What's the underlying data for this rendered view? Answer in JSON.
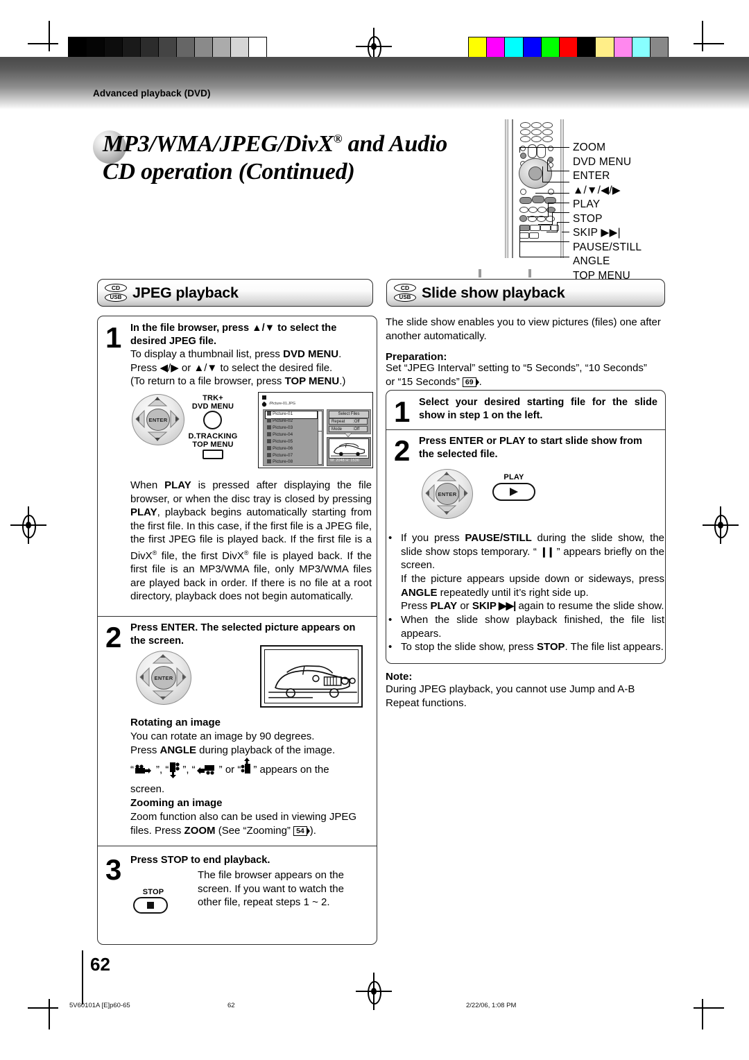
{
  "page": {
    "breadcrumb": "Advanced playback (DVD)",
    "title_line1": "MP3/WMA/JPEG/DivX",
    "title_reg": "®",
    "title_line1_tail": " and Audio",
    "title_line2": "CD operation (Continued)",
    "page_number": "62"
  },
  "remote": {
    "labels": [
      "ZOOM",
      "DVD MENU",
      "ENTER",
      "▲/▼/◀/▶",
      "PLAY",
      "STOP",
      "SKIP ▶▶|",
      "PAUSE/STILL",
      "ANGLE",
      "TOP MENU"
    ]
  },
  "left": {
    "heading": {
      "badge_cd": "CD",
      "badge_usb": "USB",
      "title": "JPEG playback"
    },
    "step1": {
      "num": "1",
      "title": "In the file browser, press ▲/▼ to select the desired JPEG file.",
      "body_line1_a": "To display a thumbnail list, press ",
      "body_line1_b": "DVD MENU",
      "body_line1_c": ".",
      "body_line2": "Press ◀/▶ or ▲/▼ to select the desired file.",
      "body_line3_a": "(To return to a file browser, press ",
      "body_line3_b": "TOP MENU",
      "body_line3_c": ".)"
    },
    "dpad1": {
      "center": "ENTER"
    },
    "dvdmenu_button": {
      "cap_line1": "TRK+",
      "cap_line2": "DVD MENU"
    },
    "topmenu_button": {
      "cap_line1": "D.TRACKING",
      "cap_line2": "TOP MENU"
    },
    "osd": {
      "path": "/Picture-01.JPG",
      "files": [
        "Picture-01",
        "Picture-02",
        "Picture-03",
        "Picture-04",
        "Picture-05",
        "Picture-06",
        "Picture-07",
        "Picture-08"
      ],
      "buttons": [
        "Select Files"
      ],
      "settings": [
        {
          "label": "Repeat",
          "value": ":Off"
        },
        {
          "label": "Mode",
          "value": ":Off"
        }
      ],
      "dimensions": "W: 2048  H: 1536"
    },
    "paragraph": {
      "p1_1": "When ",
      "p1_b1": "PLAY",
      "p1_2": " is pressed after displaying the file browser, or when the disc tray is closed by pressing ",
      "p1_b2": "PLAY",
      "p1_3": ", playback begins automatically starting from the first file. In this case, if the first file is a JPEG file, the first JPEG file is played back. If the first file is a DivX",
      "p1_r1": "®",
      "p1_4": " file, the first DivX",
      "p1_r2": "®",
      "p1_5": " file is played back. If the first file is an MP3/WMA file, only MP3/WMA files are played back in order. If there is no file at a root directory, playback does not begin automatically."
    },
    "step2": {
      "num": "2",
      "title": "Press ENTER. The selected picture appears on the screen."
    },
    "rotating": {
      "heading": "Rotating an image",
      "line1": "You can rotate an image by 90 degrees.",
      "line2_a": "Press ",
      "line2_b": "ANGLE",
      "line2_c": " during playback of the image.",
      "icons_line_a": "“",
      "icons_line_b": "”, “",
      "icons_line_c": "”, “",
      "icons_line_d": "” or “",
      "icons_line_e": "” appears on the",
      "icons_line_f": "screen."
    },
    "zooming": {
      "heading": "Zooming an image",
      "line1": "Zoom function also can be used in viewing JPEG",
      "line2_a": "files. Press ",
      "line2_b": "ZOOM",
      "line2_c": " (See “Zooming” ",
      "ref": "54",
      "line2_d": ")."
    },
    "step3": {
      "num": "3",
      "title": "Press STOP to end playback.",
      "body": "The file browser appears on the screen. If you want to watch the other file, repeat steps 1 ~ 2.",
      "button_cap": "STOP"
    }
  },
  "right": {
    "heading": {
      "badge_cd": "CD",
      "badge_usb": "USB",
      "title": "Slide show playback"
    },
    "intro": "The slide show enables you to view pictures (files) one after another automatically.",
    "preparation": {
      "heading": "Preparation:",
      "line1": "Set “JPEG Interval” setting to “5 Seconds”, “10 Seconds”",
      "line2_a": "or “15 Seconds” ",
      "ref": "69",
      "line2_b": "."
    },
    "step1": {
      "num": "1",
      "title": "Select your desired starting file for the slide show in step 1 on the left."
    },
    "step2": {
      "num": "2",
      "title": "Press ENTER or PLAY to start slide show from the selected file.",
      "dpad_center": "ENTER",
      "play_cap": "PLAY"
    },
    "bullets": [
      {
        "b1_a": "If you press ",
        "b1_b": "PAUSE/STILL",
        "b1_c": " during the slide show, the slide show stops temporary. “ ",
        "b1_icon": "❙❙",
        "b1_d": " ” appears briefly on the screen.",
        "b2_a": "If the picture appears upside down or sideways, press ",
        "b2_b": "ANGLE",
        "b2_c": " repeatedly until it’s right side up.",
        "b3_a": "Press ",
        "b3_b": "PLAY",
        "b3_c": " or ",
        "b3_d": "SKIP",
        "b3_icon": " ▶▶|",
        "b3_e": " again to resume the slide show."
      },
      {
        "text": "When the slide show playback finished, the file list appears."
      },
      {
        "t_a": "To stop the slide show, press ",
        "t_b": "STOP",
        "t_c": ". The file list appears."
      }
    ],
    "note": {
      "heading": "Note:",
      "text": "During JPEG playback, you cannot use Jump and A-B Repeat functions."
    }
  },
  "footer": {
    "left": "5V60101A [E]p60-65",
    "center": "62",
    "right": "2/22/06, 1:08 PM"
  },
  "colors": {
    "grey_ramp": [
      "#000000",
      "#050505",
      "#0d0d0d",
      "#1a1a1a",
      "#2c2c2c",
      "#444444",
      "#666666",
      "#8a8a8a",
      "#ababab",
      "#d5d5d5",
      "#ffffff"
    ],
    "color_ramp": [
      "#ffff00",
      "#ff00ff",
      "#00ffff",
      "#0000ff",
      "#00ff00",
      "#ff0000",
      "#000000",
      "#ffee88",
      "#ff88ee",
      "#88ffff",
      "#888888"
    ]
  }
}
